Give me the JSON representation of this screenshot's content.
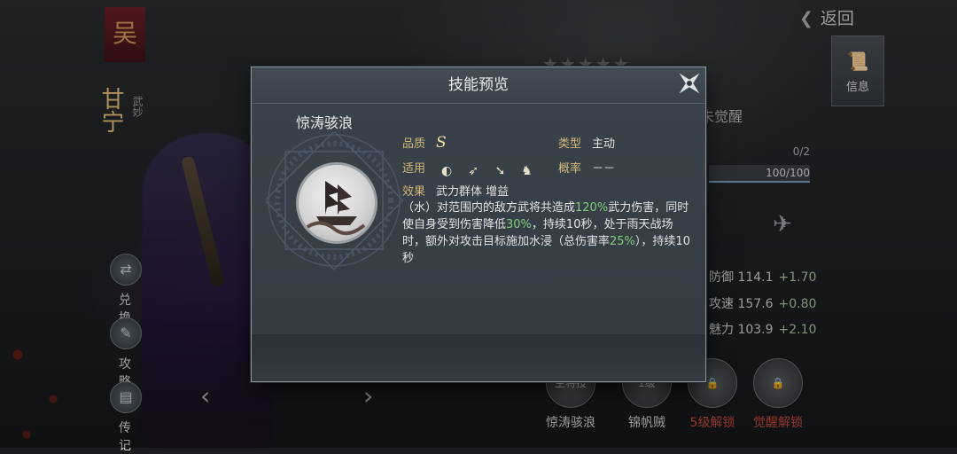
{
  "background": {
    "faction_badge": "吴",
    "hero_name": "甘宁",
    "hero_tags": "武妙",
    "side_buttons": [
      {
        "label": "兑换",
        "icon": "exchange-icon"
      },
      {
        "label": "攻略",
        "icon": "guide-icon"
      },
      {
        "label": "传记",
        "icon": "biography-icon"
      }
    ],
    "back_label": "返回",
    "info_tab_label": "信息",
    "awaken_status": "未觉醒",
    "progress_a": "0/2",
    "progress_b": "100/100",
    "stats": [
      {
        "name": "防御",
        "value": "114.1",
        "plus": "+1.70"
      },
      {
        "name": "攻速",
        "value": "157.6",
        "plus": "+0.80"
      },
      {
        "name": "魅力",
        "value": "103.9",
        "plus": "+2.10"
      }
    ],
    "skill_slots": [
      {
        "badge": "主将技",
        "label": "惊涛骇浪"
      },
      {
        "badge": "1级",
        "label": "锦帆贼"
      },
      {
        "badge": "",
        "label": "5级解锁"
      },
      {
        "badge": "",
        "label": "觉醒解锁"
      }
    ]
  },
  "modal": {
    "title": "技能预览",
    "skill_name": "惊涛骇浪",
    "quality_label": "品质",
    "quality_value": "S",
    "type_label": "类型",
    "type_value": "主动",
    "apply_label": "适用",
    "apply_icons": [
      "shield-unit-icon",
      "bow-unit-icon",
      "spear-unit-icon",
      "cavalry-unit-icon"
    ],
    "rate_label": "概率",
    "rate_value": "－－",
    "effect_label": "效果",
    "effect_value": "武力群体 增益",
    "description_parts": [
      {
        "text": "（水）对范围内的敌方武将共造成",
        "hl": false
      },
      {
        "text": "120%",
        "hl": true
      },
      {
        "text": "武力伤害，同时使自身受到伤害降低",
        "hl": false
      },
      {
        "text": "30%",
        "hl": true
      },
      {
        "text": "，持续10秒，处于雨天战场时，额外对攻击目标施加水浸（总伤害率",
        "hl": false
      },
      {
        "text": "25%",
        "hl": true
      },
      {
        "text": "），持续10秒",
        "hl": false
      }
    ]
  },
  "colors": {
    "highlight": "#7fcf7a",
    "label_gold": "#d2b979",
    "lock_red": "#c8473c"
  }
}
